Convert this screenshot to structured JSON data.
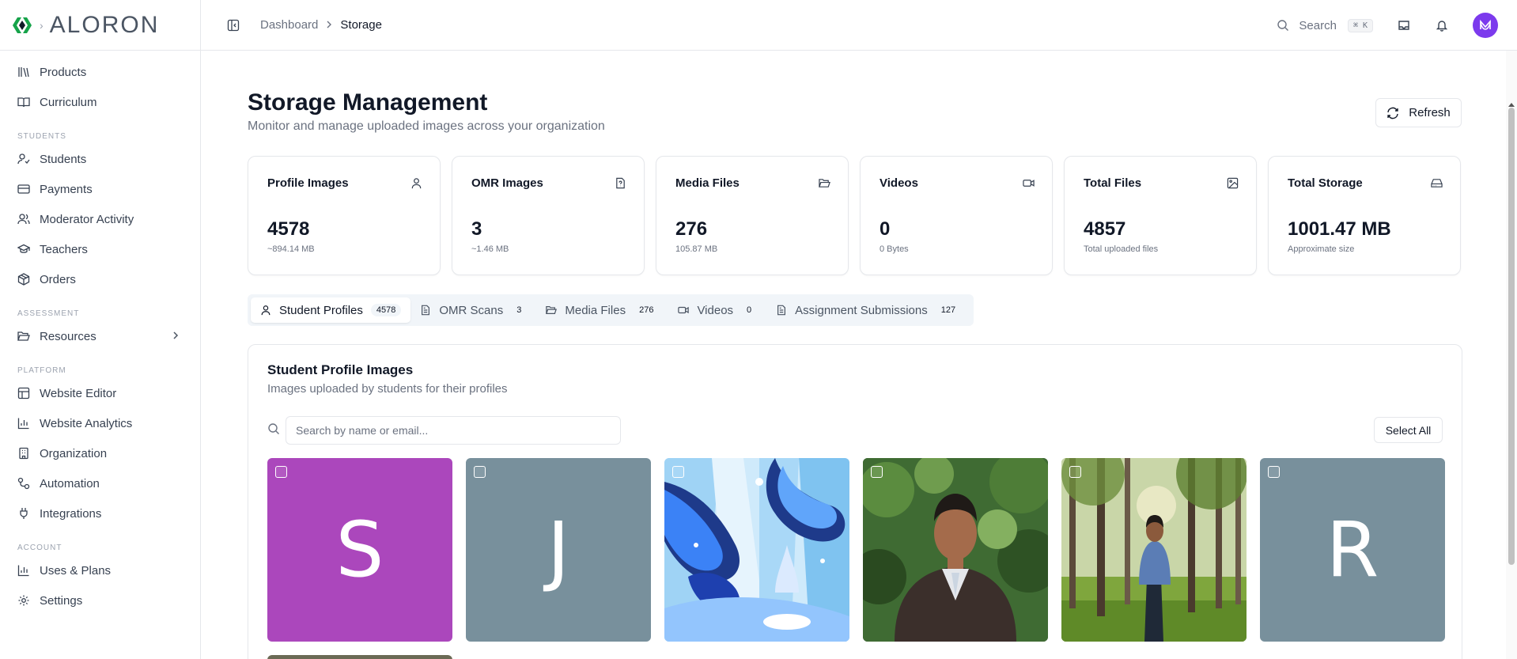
{
  "brand": {
    "logo_text": "ALORON"
  },
  "sidebar": {
    "top_items": [
      {
        "label": "Products",
        "icon": "library-icon"
      },
      {
        "label": "Curriculum",
        "icon": "book-open-icon"
      }
    ],
    "sections": [
      {
        "title": "STUDENTS",
        "items": [
          {
            "label": "Students",
            "icon": "user-check-icon"
          },
          {
            "label": "Payments",
            "icon": "credit-card-icon"
          },
          {
            "label": "Moderator Activity",
            "icon": "users-icon"
          },
          {
            "label": "Teachers",
            "icon": "graduation-cap-icon"
          },
          {
            "label": "Orders",
            "icon": "package-icon"
          }
        ]
      },
      {
        "title": "ASSESSMENT",
        "items": [
          {
            "label": "Resources",
            "icon": "folder-open-icon"
          }
        ]
      },
      {
        "title": "PLATFORM",
        "items": [
          {
            "label": "Website Editor",
            "icon": "layout-icon"
          },
          {
            "label": "Website Analytics",
            "icon": "bar-chart-icon"
          },
          {
            "label": "Organization",
            "icon": "building-icon"
          },
          {
            "label": "Automation",
            "icon": "workflow-icon"
          },
          {
            "label": "Integrations",
            "icon": "plug-icon"
          }
        ]
      },
      {
        "title": "ACCOUNT",
        "items": [
          {
            "label": "Uses & Plans",
            "icon": "bar-chart-icon"
          },
          {
            "label": "Settings",
            "icon": "gear-icon"
          }
        ]
      }
    ]
  },
  "topbar": {
    "breadcrumb": [
      "Dashboard",
      "Storage"
    ],
    "search_label": "Search",
    "search_shortcut": "⌘ K",
    "avatar_initial": "M"
  },
  "page": {
    "title": "Storage Management",
    "subtitle": "Monitor and manage uploaded images across your organization",
    "refresh_label": "Refresh"
  },
  "stats": [
    {
      "label": "Profile Images",
      "value": "4578",
      "sub": "~894.14 MB",
      "icon": "user-icon"
    },
    {
      "label": "OMR Images",
      "value": "3",
      "sub": "~1.46 MB",
      "icon": "file-question-icon"
    },
    {
      "label": "Media Files",
      "value": "276",
      "sub": "105.87 MB",
      "icon": "folder-open-icon"
    },
    {
      "label": "Videos",
      "value": "0",
      "sub": "0 Bytes",
      "icon": "video-icon"
    },
    {
      "label": "Total Files",
      "value": "4857",
      "sub": "Total uploaded files",
      "icon": "image-icon"
    },
    {
      "label": "Total Storage",
      "value": "1001.47 MB",
      "sub": "Approximate size",
      "icon": "hard-drive-icon"
    }
  ],
  "tabs": [
    {
      "label": "Student Profiles",
      "count": "4578",
      "icon": "user-icon"
    },
    {
      "label": "OMR Scans",
      "count": "3",
      "icon": "file-text-icon"
    },
    {
      "label": "Media Files",
      "count": "276",
      "icon": "folder-open-icon"
    },
    {
      "label": "Videos",
      "count": "0",
      "icon": "video-icon"
    },
    {
      "label": "Assignment Submissions",
      "count": "127",
      "icon": "file-text-icon"
    }
  ],
  "panel": {
    "title": "Student Profile Images",
    "subtitle": "Images uploaded by students for their profiles",
    "search_placeholder": "Search by name or email...",
    "select_all_label": "Select All",
    "thumbnails": [
      {
        "kind": "letter",
        "letter": "S",
        "bg": "#ab47bc"
      },
      {
        "kind": "letter",
        "letter": "J",
        "bg": "#78909c"
      },
      {
        "kind": "photo",
        "desc": "abstract-blue-illustration"
      },
      {
        "kind": "photo",
        "desc": "man-in-suit-portrait"
      },
      {
        "kind": "photo",
        "desc": "man-in-forest-photo"
      },
      {
        "kind": "letter",
        "letter": "R",
        "bg": "#78909c"
      }
    ]
  },
  "colors": {
    "accent": "#7c3aed",
    "brand_green": "#16a34a",
    "border": "#e5e7eb"
  }
}
